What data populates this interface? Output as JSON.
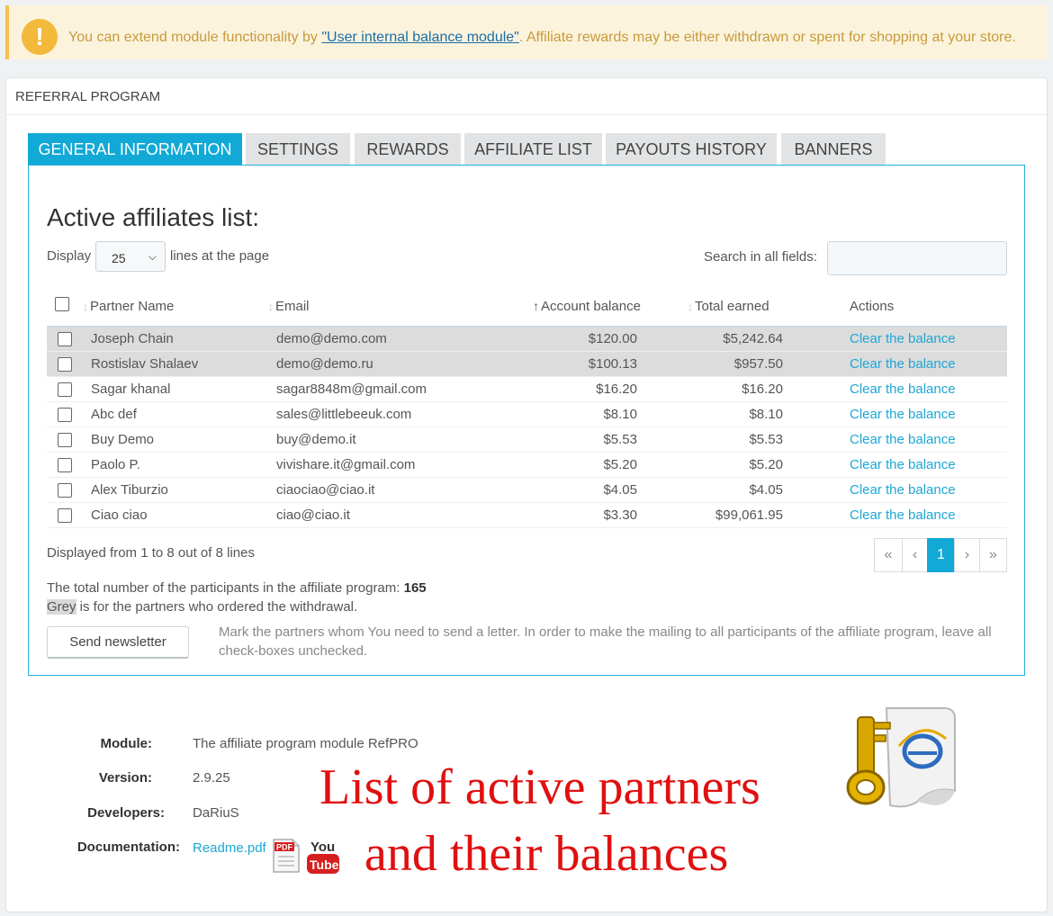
{
  "alert": {
    "icon": "!",
    "text_before": "You can extend module functionality by ",
    "link": "\"User internal balance module\"",
    "text_after": ". Affiliate rewards may be either withdrawn or spent for shopping at your store."
  },
  "panel": {
    "title": "REFERRAL PROGRAM"
  },
  "tabs": [
    {
      "label": "GENERAL INFORMATION",
      "active": true
    },
    {
      "label": "SETTINGS"
    },
    {
      "label": "REWARDS"
    },
    {
      "label": "AFFILIATE LIST"
    },
    {
      "label": "PAYOUTS HISTORY"
    },
    {
      "label": "BANNERS"
    }
  ],
  "list": {
    "title": "Active affiliates list:",
    "display_label": "Display",
    "display_value": "25",
    "lines_label": "lines at the page",
    "search_label": "Search in all fields:",
    "search_value": ""
  },
  "table": {
    "headers": [
      "Partner Name",
      "Email",
      "Account balance",
      "Total earned",
      "Actions"
    ],
    "rows": [
      {
        "name": "Joseph Chain",
        "email": "demo@demo.com",
        "balance": "$120.00",
        "earned": "$5,242.64",
        "action": "Clear the balance",
        "grey": true
      },
      {
        "name": "Rostislav Shalaev",
        "email": "demo@demo.ru",
        "balance": "$100.13",
        "earned": "$957.50",
        "action": "Clear the balance",
        "grey": true
      },
      {
        "name": "Sagar khanal",
        "email": "sagar8848m@gmail.com",
        "balance": "$16.20",
        "earned": "$16.20",
        "action": "Clear the balance",
        "grey": false
      },
      {
        "name": "Abc def",
        "email": "sales@littlebeeuk.com",
        "balance": "$8.10",
        "earned": "$8.10",
        "action": "Clear the balance",
        "grey": false
      },
      {
        "name": "Buy Demo",
        "email": "buy@demo.it",
        "balance": "$5.53",
        "earned": "$5.53",
        "action": "Clear the balance",
        "grey": false
      },
      {
        "name": "Paolo P.",
        "email": "vivishare.it@gmail.com",
        "balance": "$5.20",
        "earned": "$5.20",
        "action": "Clear the balance",
        "grey": false
      },
      {
        "name": "Alex Tiburzio",
        "email": "ciaociao@ciao.it",
        "balance": "$4.05",
        "earned": "$4.05",
        "action": "Clear the balance",
        "grey": false
      },
      {
        "name": "Ciao ciao",
        "email": "ciao@ciao.it",
        "balance": "$3.30",
        "earned": "$99,061.95",
        "action": "Clear the balance",
        "grey": false
      }
    ]
  },
  "pagination": {
    "info": "Displayed from 1 to 8 out of 8 lines",
    "first": "«",
    "prev": "‹",
    "current": "1",
    "next": "›",
    "last": "»"
  },
  "totals": {
    "label": "The total number of the participants in the affiliate program:",
    "count": "165",
    "grey_word": "Grey",
    "grey_text": " is for the partners who ordered the withdrawal."
  },
  "newsletter": {
    "button": "Send newsletter",
    "note": "Mark the partners whom You need to send a letter. In order to make the mailing to all participants of the affiliate program, leave all check-boxes unchecked."
  },
  "module_info": {
    "module_label": "Module:",
    "module_value": "The affiliate program module RefPRO",
    "version_label": "Version:",
    "version_value": "2.9.25",
    "developers_label": "Developers:",
    "developers_value": "DaRiuS",
    "documentation_label": "Documentation:",
    "documentation_value": "Readme.pdf",
    "pdf_icon_text": "PDF",
    "youtube_icon_text_1": "You",
    "youtube_icon_text_2": "Tube"
  },
  "overlay": {
    "line1": "List of active partners",
    "line2": "and their balances"
  },
  "colors": {
    "accent": "#12a9d6",
    "link": "#1fa6d4",
    "overlay_red": "#e01010",
    "alert_bg": "#fcf3dd"
  }
}
